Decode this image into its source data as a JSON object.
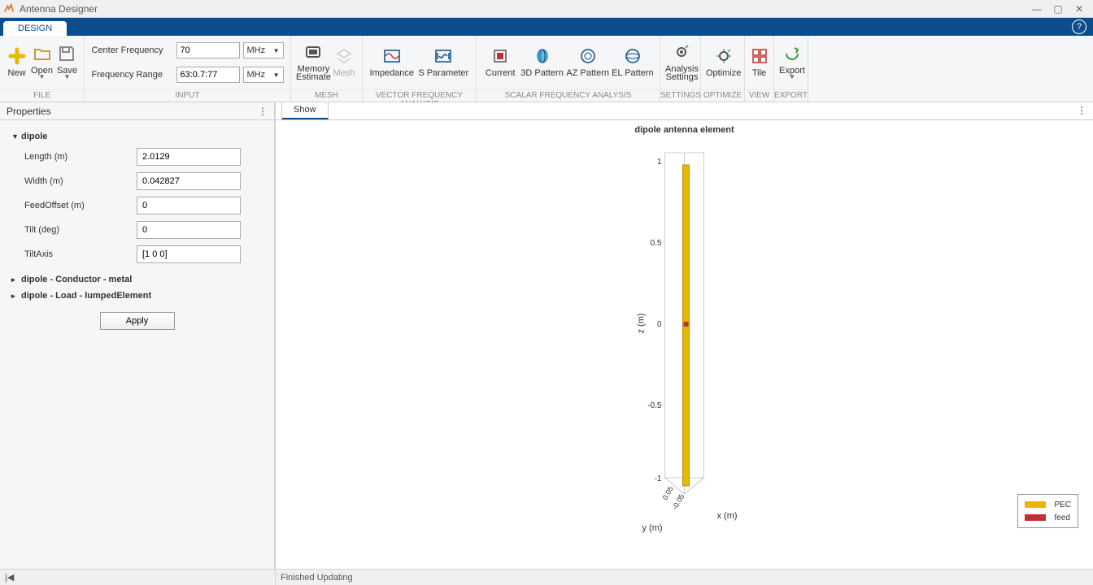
{
  "window": {
    "title": "Antenna Designer"
  },
  "tab": {
    "design": "DESIGN"
  },
  "ribbon": {
    "file": {
      "new": "New",
      "open": "Open",
      "save": "Save",
      "footer": "FILE"
    },
    "input": {
      "cf_label": "Center Frequency",
      "cf_value": "70",
      "cf_unit": "MHz",
      "fr_label": "Frequency Range",
      "fr_value": "63:0.7:77",
      "fr_unit": "MHz",
      "footer": "INPUT"
    },
    "mesh": {
      "memory": "Memory",
      "estimate": "Estimate",
      "mesh": "Mesh",
      "footer": "MESH"
    },
    "vfa": {
      "impedance": "Impedance",
      "sparam": "S Parameter",
      "footer": "VECTOR FREQUENCY ANALYSIS"
    },
    "sfa": {
      "current": "Current",
      "p3d": "3D Pattern",
      "az": "AZ Pattern",
      "el": "EL Pattern",
      "footer": "SCALAR FREQUENCY ANALYSIS"
    },
    "settings": {
      "analysis": "Analysis",
      "settings": "Settings",
      "footer": "SETTINGS"
    },
    "optimize": {
      "optimize": "Optimize",
      "footer": "OPTIMIZE"
    },
    "view": {
      "tile": "Tile",
      "footer": "VIEW"
    },
    "export": {
      "export": "Export",
      "footer": "EXPORT"
    }
  },
  "properties": {
    "header": "Properties",
    "root": "dipole",
    "rows": [
      {
        "label": "Length (m)",
        "value": "2.0129"
      },
      {
        "label": "Width (m)",
        "value": "0.042827"
      },
      {
        "label": "FeedOffset (m)",
        "value": "0"
      },
      {
        "label": "Tilt (deg)",
        "value": "0"
      },
      {
        "label": "TiltAxis",
        "value": "[1 0 0]"
      }
    ],
    "sub1": "dipole - Conductor - metal",
    "sub2": "dipole - Load - lumpedElement",
    "apply": "Apply"
  },
  "canvas": {
    "tab": "Show",
    "title": "dipole antenna element",
    "zlabel": "z (m)",
    "ylabel": "y (m)",
    "xlabel": "x (m)",
    "z_ticks": [
      "1",
      "0.5",
      "0",
      "-0.5",
      "-1"
    ],
    "xy_ticks": [
      "0.05",
      "-0.05"
    ],
    "legend": [
      {
        "label": "PEC",
        "color": "#e6b800"
      },
      {
        "label": "feed",
        "color": "#c03030"
      }
    ]
  },
  "status": {
    "right": "Finished Updating"
  }
}
